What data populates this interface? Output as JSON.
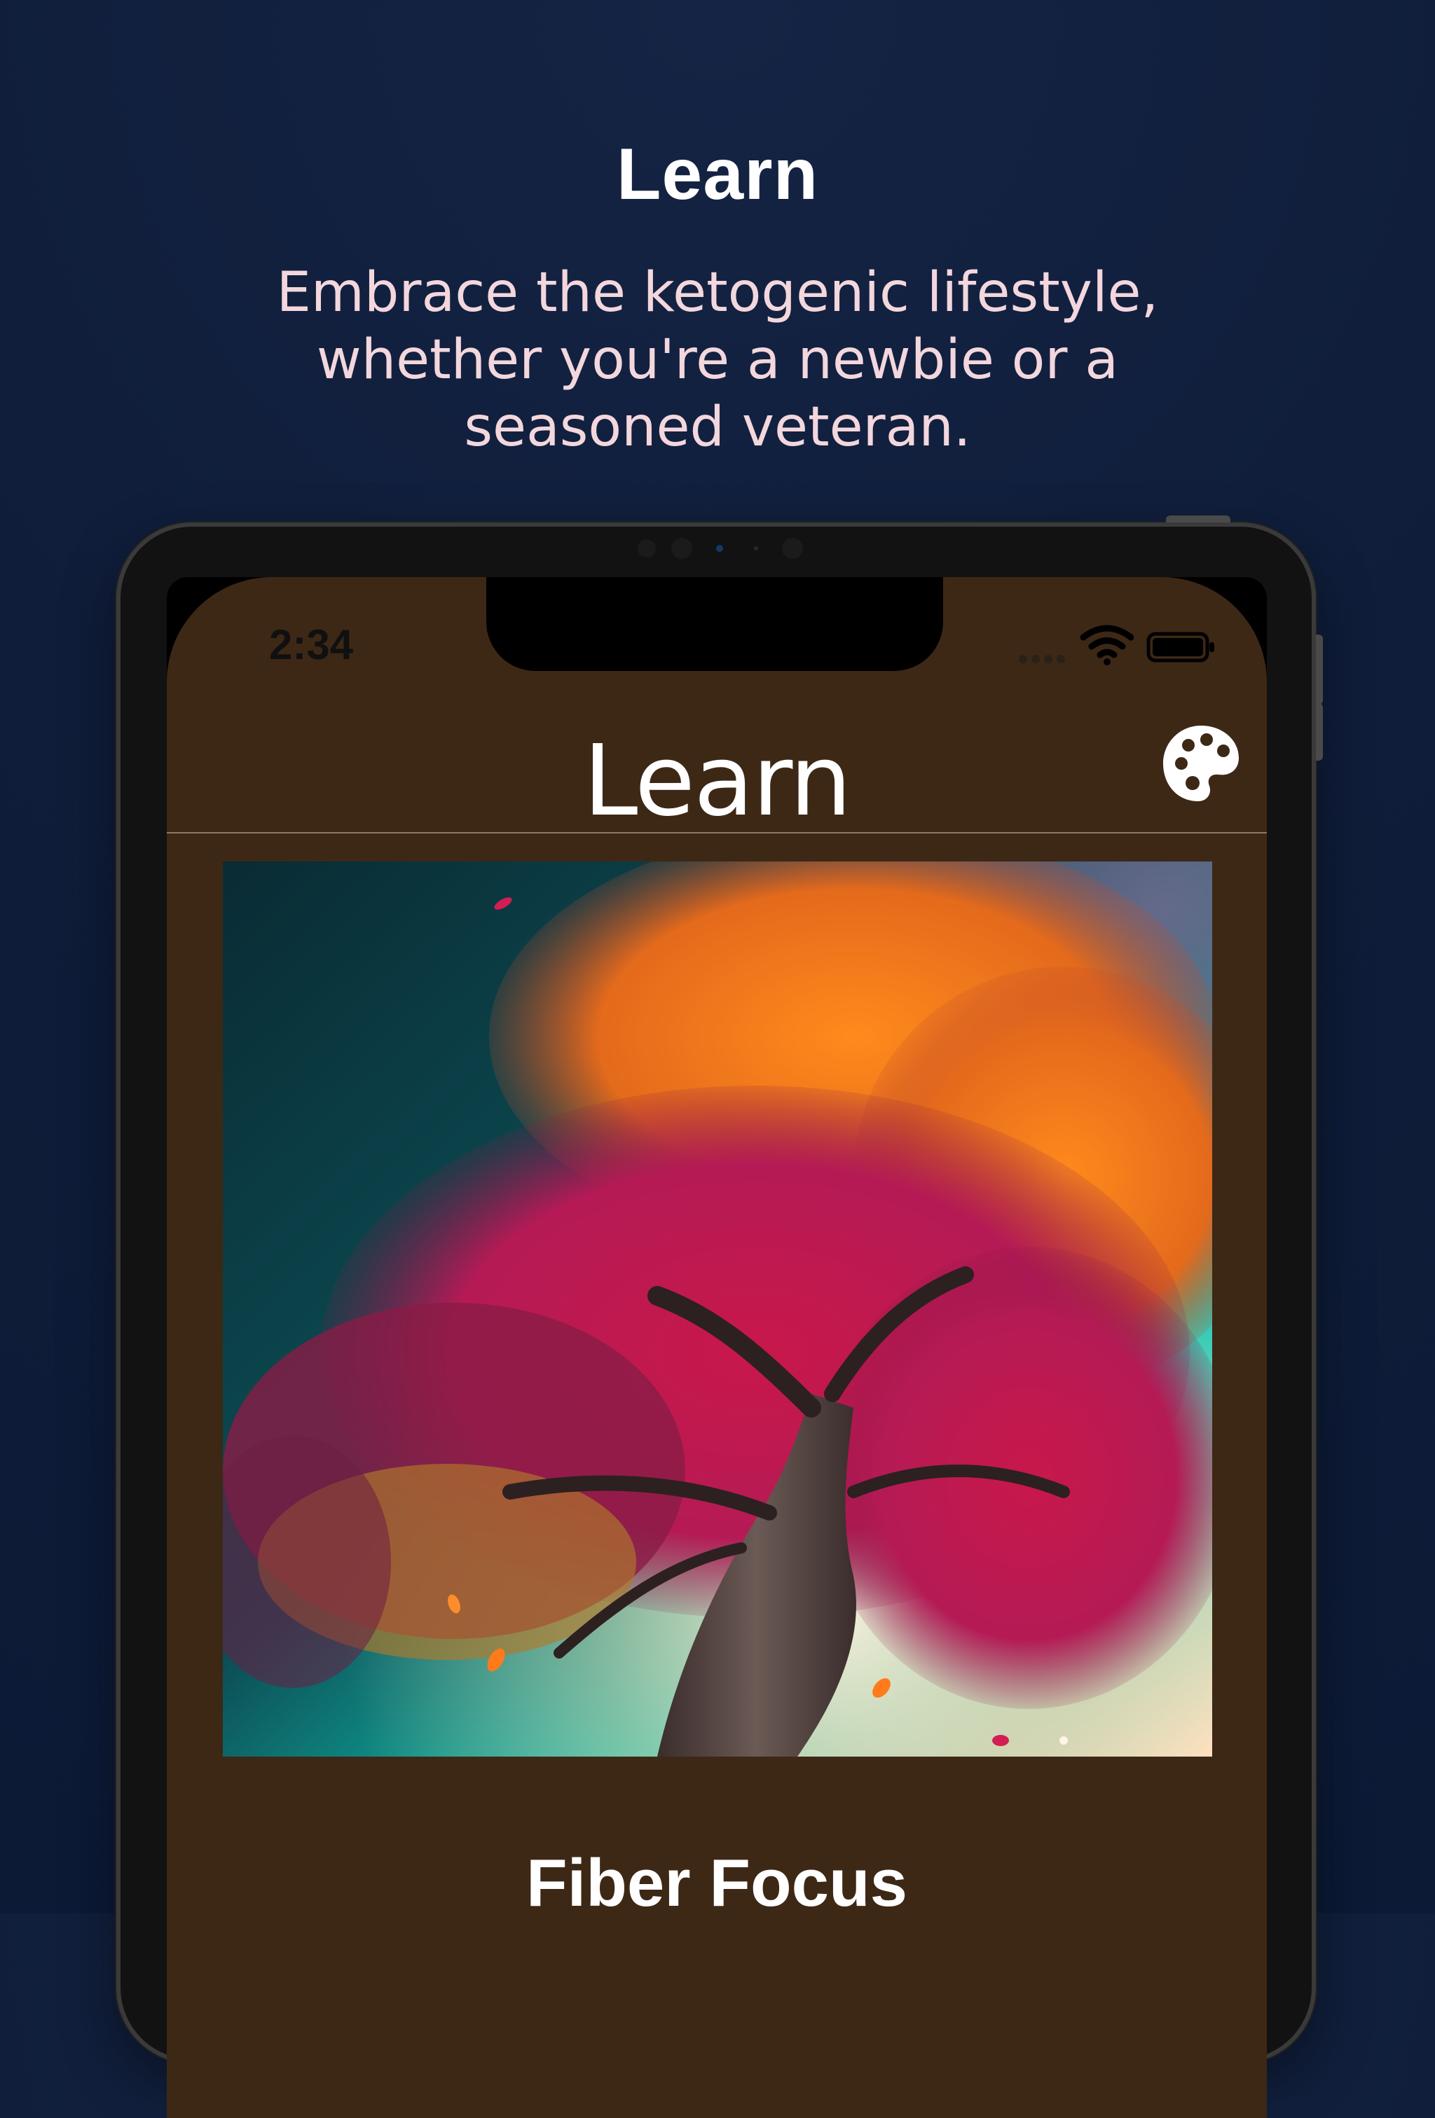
{
  "marketing": {
    "title": "Learn",
    "subtitle": "Embrace the ketogenic lifestyle, whether you're a newbie or a seasoned veteran."
  },
  "status_bar": {
    "time": "2:34",
    "wifi_icon": "wifi-icon",
    "battery_icon": "battery-icon"
  },
  "nav": {
    "title": "Learn",
    "palette_icon": "palette-icon"
  },
  "article": {
    "title": "Fiber Focus",
    "image": "autumn-tree-image"
  },
  "colors": {
    "page_background": "#0f1d3a",
    "app_background": "#3d2816",
    "subtitle_text": "#f3d7dd",
    "nav_divider": "#8d7a64"
  }
}
